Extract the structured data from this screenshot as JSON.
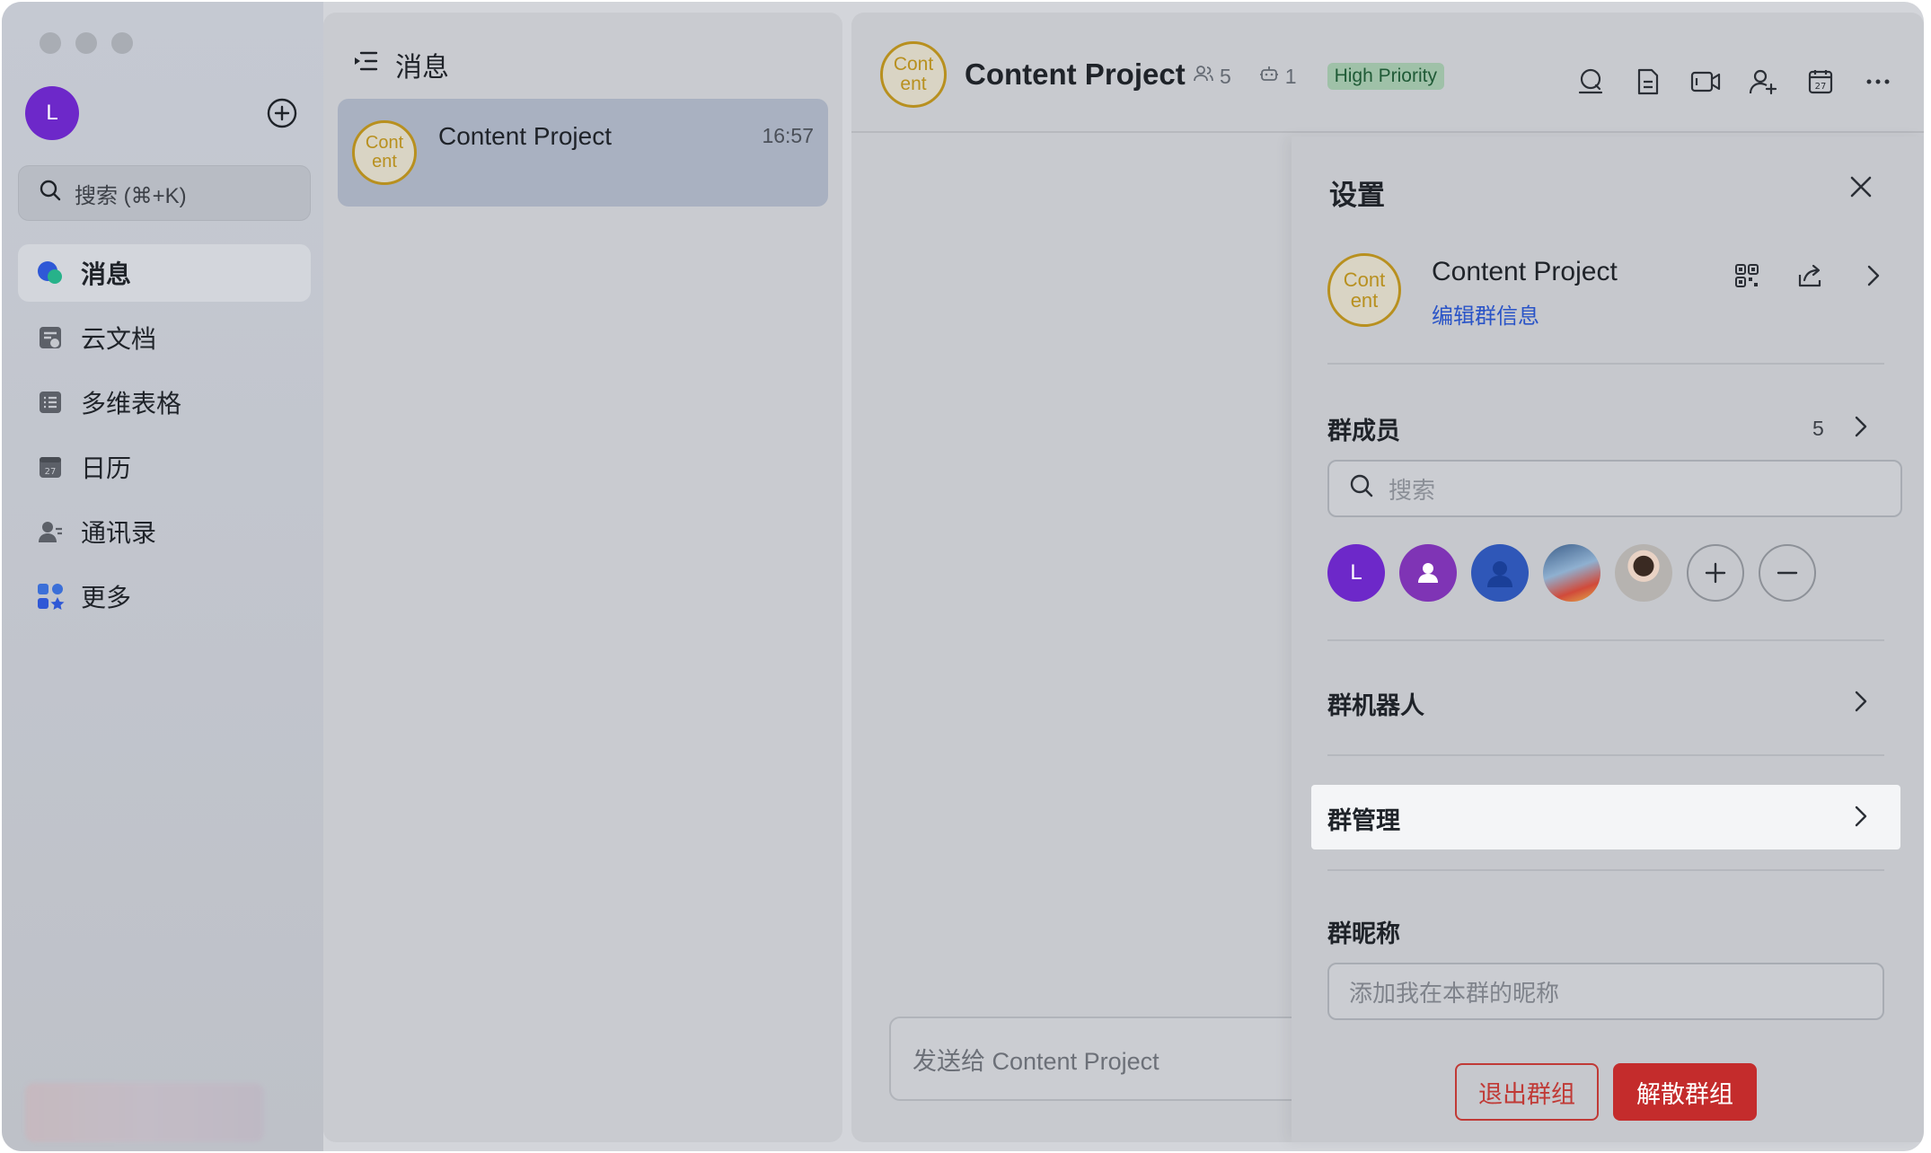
{
  "sidebar": {
    "user_initial": "L",
    "search_placeholder": "搜索 (⌘+K)",
    "items": [
      {
        "label": "消息",
        "icon": "message-bubble-icon",
        "active": true
      },
      {
        "label": "云文档",
        "icon": "cloud-doc-icon"
      },
      {
        "label": "多维表格",
        "icon": "base-table-icon"
      },
      {
        "label": "日历",
        "icon": "calendar-icon"
      },
      {
        "label": "通讯录",
        "icon": "contacts-icon"
      },
      {
        "label": "更多",
        "icon": "more-apps-icon"
      }
    ]
  },
  "chat_list": {
    "title": "消息",
    "items": [
      {
        "avatar_text_1": "Cont",
        "avatar_text_2": "ent",
        "name": "Content Project",
        "time": "16:57"
      }
    ]
  },
  "chat": {
    "avatar_text_1": "Cont",
    "avatar_text_2": "ent",
    "title": "Content Project",
    "member_count": "5",
    "bot_count": "1",
    "badge": "High Priority",
    "composer_placeholder": "发送给 Content Project"
  },
  "settings": {
    "title": "设置",
    "group_name": "Content Project",
    "edit_link": "编辑群信息",
    "members_label": "群成员",
    "members_count": "5",
    "members_search_placeholder": "搜索",
    "member_l_initial": "L",
    "bots_label": "群机器人",
    "manage_label": "群管理",
    "nickname_label": "群昵称",
    "nickname_placeholder": "添加我在本群的昵称",
    "quit_button": "退出群组",
    "disband_button": "解散群组"
  },
  "colors": {
    "accent_purple": "#6d28c9",
    "content_avatar_gold": "#b8901f",
    "danger": "#c42c2c",
    "link_blue": "#2a54c7",
    "badge_green_bg": "#9fc1a8"
  }
}
